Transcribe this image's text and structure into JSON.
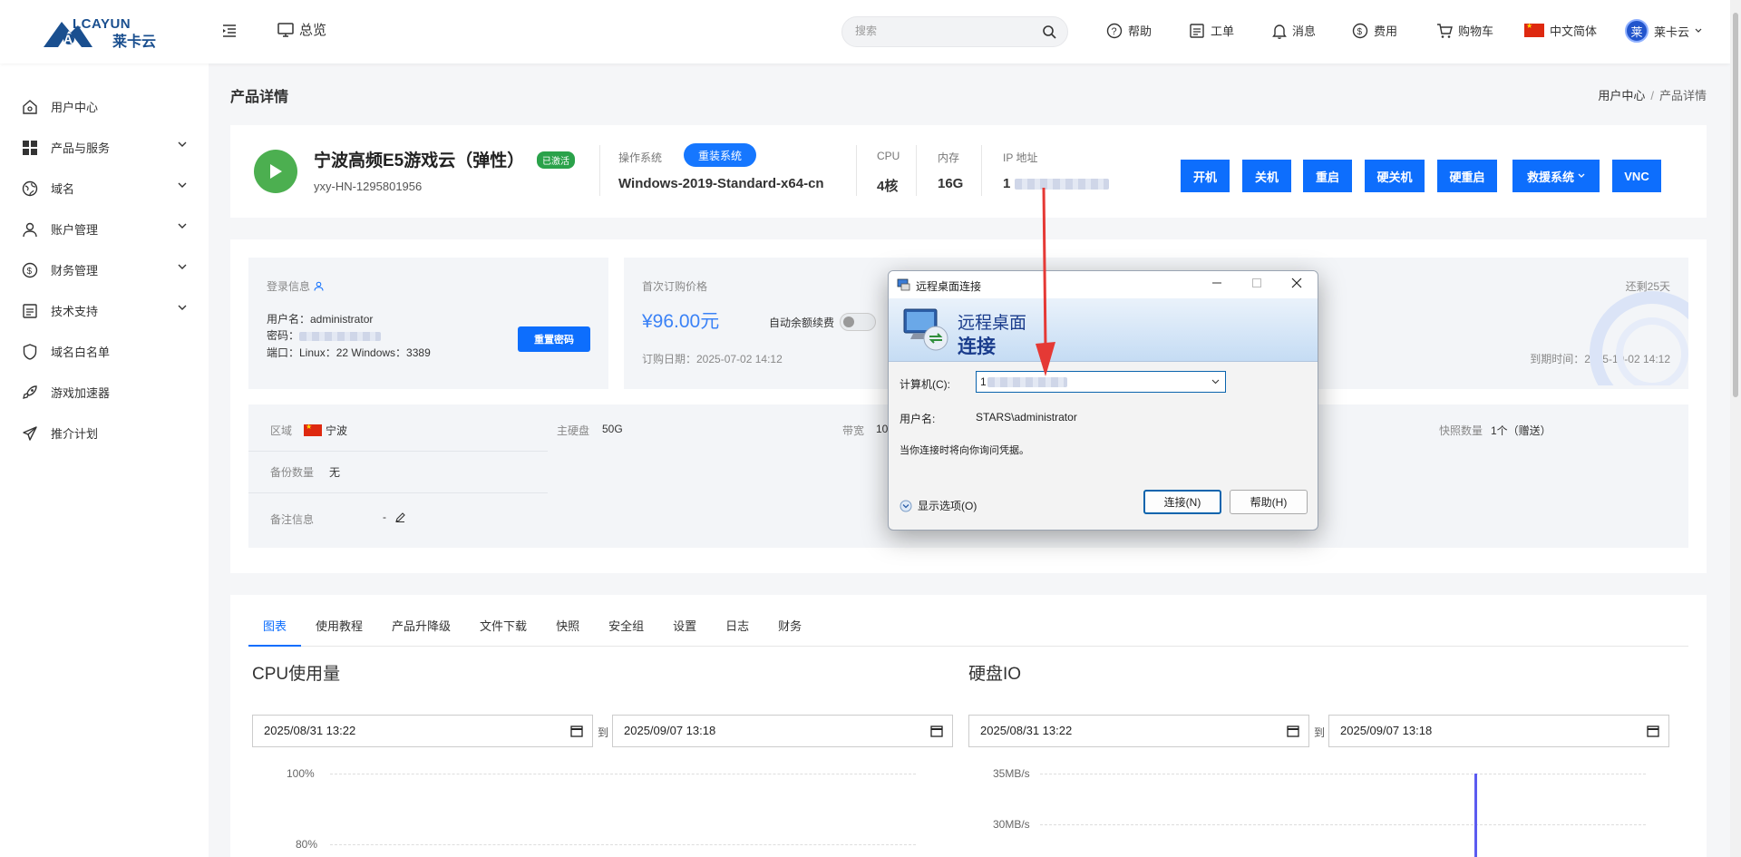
{
  "header": {
    "logo_text": "LCAYUN",
    "logo_sub": "莱卡云",
    "overview": "总览",
    "search_placeholder": "搜索",
    "nav": [
      "帮助",
      "工单",
      "消息",
      "费用",
      "购物车",
      "中文简体"
    ],
    "user_name": "莱卡云",
    "avatar_char": "莱"
  },
  "sidebar": {
    "items": [
      {
        "label": "用户中心",
        "icon": "home-icon"
      },
      {
        "label": "产品与服务",
        "icon": "grid-icon"
      },
      {
        "label": "域名",
        "icon": "globe-icon"
      },
      {
        "label": "账户管理",
        "icon": "user-icon"
      },
      {
        "label": "财务管理",
        "icon": "dollar-icon"
      },
      {
        "label": "技术支持",
        "icon": "support-icon"
      },
      {
        "label": "域名白名单",
        "icon": "shield-icon"
      },
      {
        "label": "游戏加速器",
        "icon": "rocket-icon"
      },
      {
        "label": "推介计划",
        "icon": "send-icon"
      }
    ]
  },
  "page": {
    "title": "产品详情",
    "breadcrumb_home": "用户中心",
    "breadcrumb_sep": "/",
    "breadcrumb_current": "产品详情"
  },
  "product": {
    "name": "宁波高频E5游戏云（弹性）",
    "status": "已激活",
    "id": "yxy-HN-1295801956",
    "os_label": "操作系统",
    "reinstall": "重装系统",
    "os_value": "Windows-2019-Standard-x64-cn",
    "cpu_label": "CPU",
    "cpu_value": "4核",
    "mem_label": "内存",
    "mem_value": "16G",
    "ip_label": "IP 地址",
    "ip_prefix": "1",
    "actions": [
      "开机",
      "关机",
      "重启",
      "硬关机",
      "硬重启",
      "救援系统",
      "VNC"
    ]
  },
  "login": {
    "title": "登录信息",
    "username": "用户名：administrator",
    "password_label": "密码：",
    "port": "端口：Linux：22 Windows：3389",
    "reset": "重置密码"
  },
  "billing": {
    "first_price_label": "首次订购价格",
    "price": "¥96.00元",
    "auto_renew": "自动余额续费",
    "order_date": "订购日期：2025-07-02 14:12",
    "remaining": "还剩25天",
    "expire": "到期时间：2025-10-02 14:12"
  },
  "info": {
    "region_label": "区域",
    "region": "宁波",
    "disk_label": "主硬盘",
    "disk": "50G",
    "bw_label": "带宽",
    "bw": "10",
    "snapshot_label": "快照数量",
    "snapshot": "1个（赠送）",
    "backup_label": "备份数量",
    "backup": "无",
    "note_label": "备注信息",
    "note": "-"
  },
  "tabs": [
    "图表",
    "使用教程",
    "产品升降级",
    "文件下载",
    "快照",
    "安全组",
    "设置",
    "日志",
    "财务"
  ],
  "charts": [
    {
      "title": "CPU使用量",
      "from": "2025/08/31  13:22",
      "to_label": "到",
      "to": "2025/09/07  13:18",
      "ticks": [
        "100%",
        "80%"
      ]
    },
    {
      "title": "硬盘IO",
      "from": "2025/08/31  13:22",
      "to_label": "到",
      "to": "2025/09/07  13:18",
      "ticks": [
        "35MB/s",
        "30MB/s"
      ]
    }
  ],
  "dialog": {
    "title": "远程桌面连接",
    "banner_line1": "远程桌面",
    "banner_line2": "连接",
    "computer_label": "计算机(C):",
    "computer_value": "1",
    "user_label": "用户名:",
    "user_value": "STARS\\administrator",
    "note": "当你连接时将向你询问凭据。",
    "show_options": "显示选项(O)",
    "connect": "连接(N)",
    "help": "帮助(H)"
  },
  "colors": {
    "primary": "#0d6efd",
    "success": "#2aa24a",
    "arrow": "#e53935"
  }
}
